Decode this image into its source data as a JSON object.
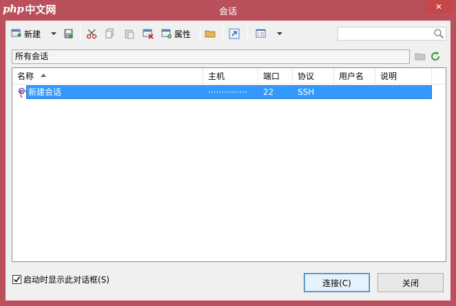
{
  "window": {
    "title": "会话",
    "close_glyph": "✕"
  },
  "logo": {
    "php": "php",
    "cn": "中文网"
  },
  "toolbar": {
    "new_label": "新建",
    "properties_label": "属性",
    "search_placeholder": ""
  },
  "address": {
    "path": "所有会话"
  },
  "table": {
    "columns": [
      "名称",
      "主机",
      "端口",
      "协议",
      "用户名",
      "说明"
    ],
    "rows": [
      {
        "name": "新建会话",
        "host": "···············",
        "port": "22",
        "protocol": "SSH",
        "username": "",
        "description": ""
      }
    ]
  },
  "footer": {
    "checkbox_label": "启动时显示此对话框(S)",
    "checkbox_checked": true,
    "connect_label": "连接(C)",
    "close_label": "关闭"
  },
  "colors": {
    "frame": "#b9505b",
    "selection": "#3399ff",
    "close": "#c7464a"
  }
}
